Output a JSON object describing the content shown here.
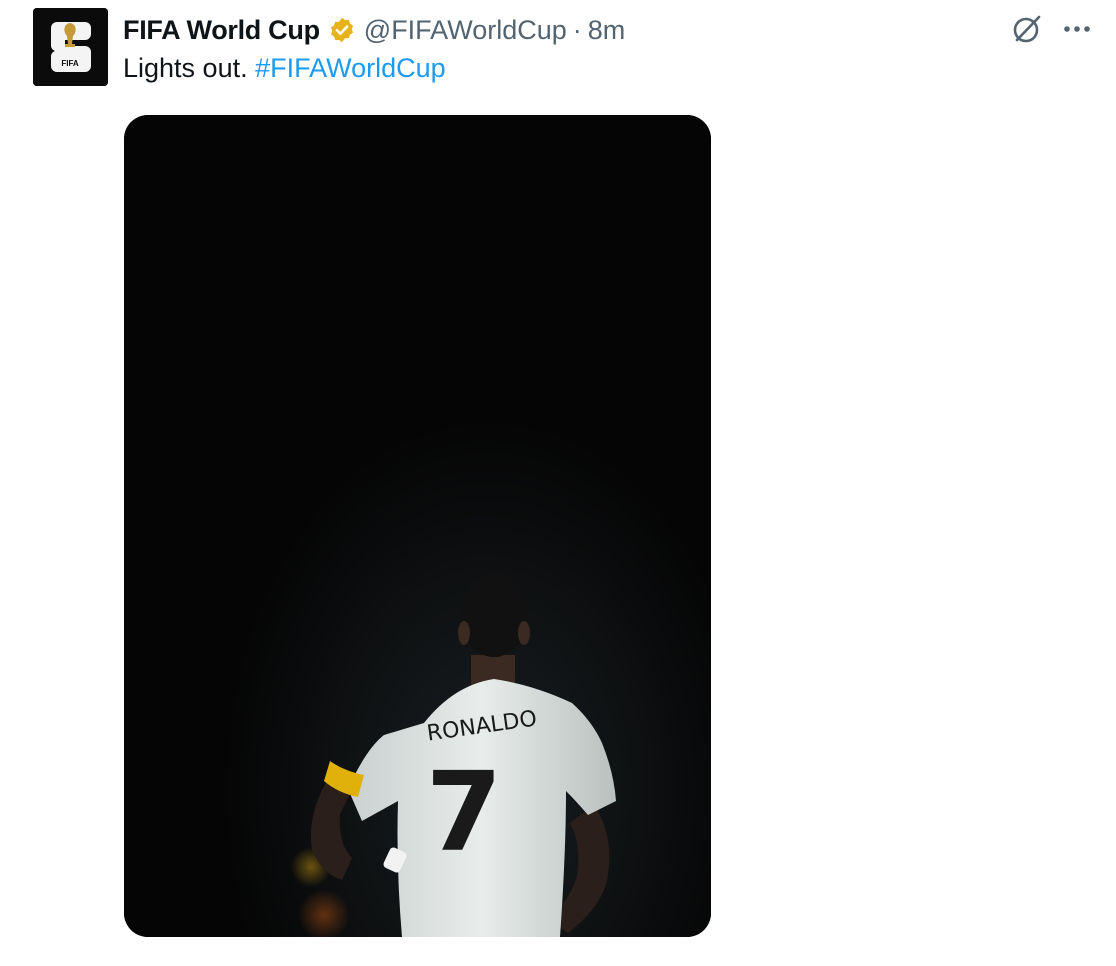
{
  "tweet": {
    "author_name": "FIFA World Cup",
    "handle": "@FIFAWorldCup",
    "separator": "·",
    "time": "8m",
    "text_plain": "Lights out.",
    "text_hashtag": "#FIFAWorldCup",
    "avatar_label": "FIFA"
  },
  "media": {
    "jersey_name": "RONALDO",
    "jersey_number": "7"
  },
  "colors": {
    "link": "#1d9bf0",
    "verified_badge": "#e8b31a",
    "text_primary": "#0f1419",
    "text_secondary": "#536471"
  },
  "icons": [
    "fifa-logo-icon",
    "verified-badge-icon",
    "grok-icon",
    "more-options-icon"
  ]
}
